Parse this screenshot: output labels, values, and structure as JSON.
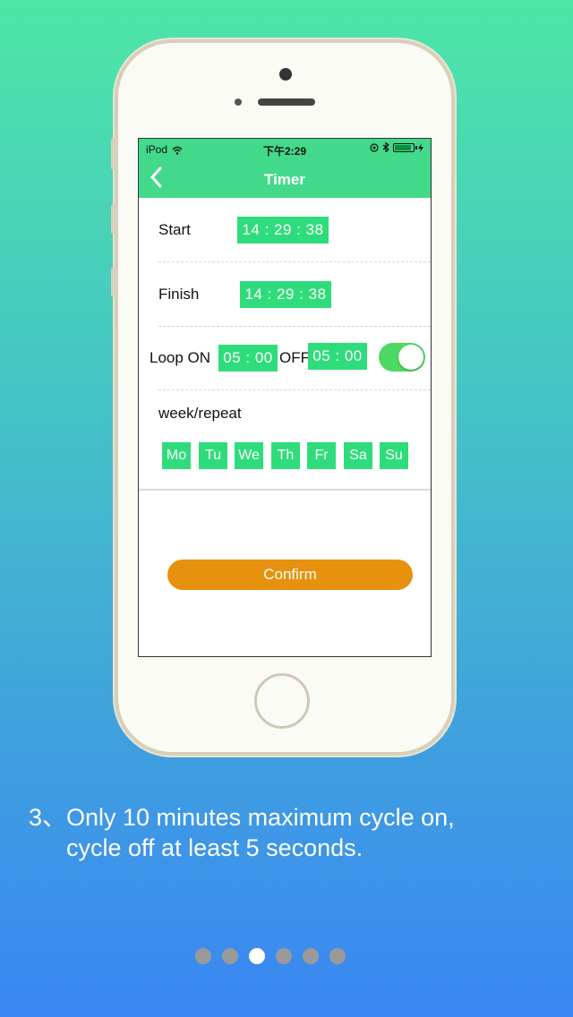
{
  "status_bar": {
    "carrier": "iPod",
    "time": "下午2:29"
  },
  "nav": {
    "title": "Timer"
  },
  "start": {
    "label": "Start",
    "time": "14 : 29 : 38"
  },
  "finish": {
    "label": "Finish",
    "time": "14 : 29 : 38"
  },
  "loop": {
    "label": "Loop ON",
    "on_time": "05 : 00",
    "off_label": "OFF",
    "off_time": "05 : 00",
    "enabled": true
  },
  "week": {
    "label": "week/repeat",
    "days": [
      "Mo",
      "Tu",
      "We",
      "Th",
      "Fr",
      "Sa",
      "Su"
    ]
  },
  "confirm": {
    "label": "Confirm"
  },
  "caption": {
    "number": "3、",
    "line1": "Only 10 minutes maximum cycle on,",
    "line2": "cycle off at least 5 seconds."
  },
  "pager": {
    "count": 6,
    "active_index": 2
  },
  "colors": {
    "header": "#43d98b",
    "time_box": "#2fdc7b",
    "confirm": "#e6920f",
    "toggle_on": "#4cd964"
  }
}
